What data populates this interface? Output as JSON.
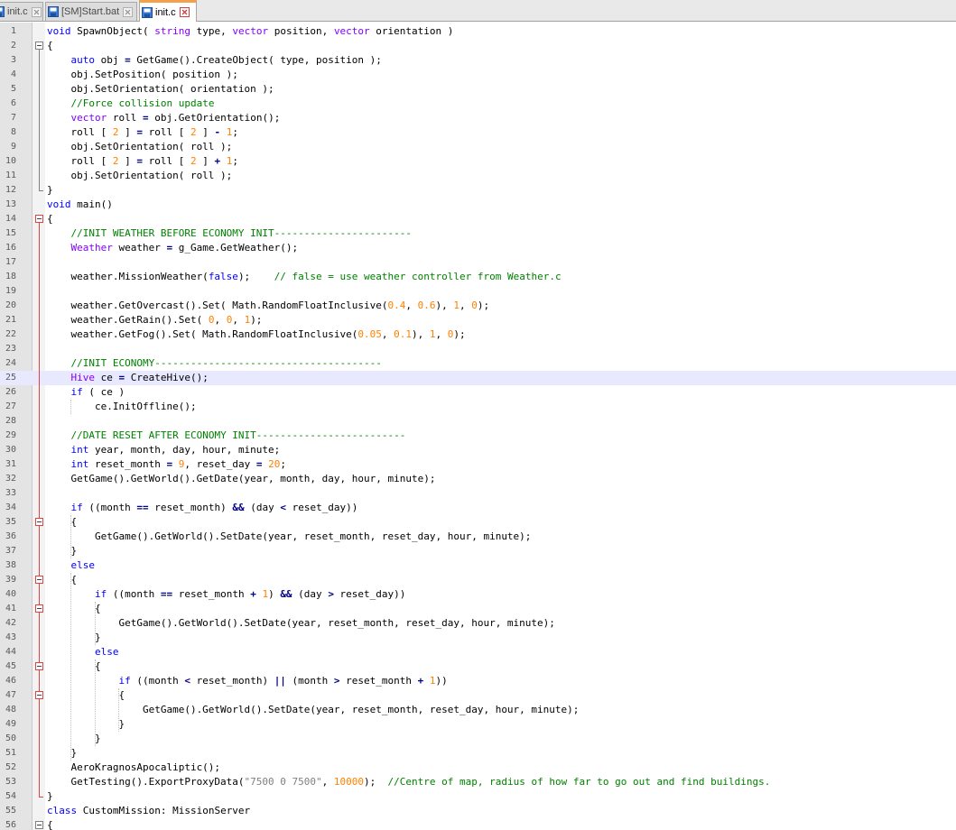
{
  "tabs": [
    {
      "label": "init.c",
      "icon": "saved-file-icon",
      "active": false,
      "close": "close-icon"
    },
    {
      "label": "[SM]Start.bat",
      "icon": "saved-file-icon",
      "active": false,
      "close": "close-icon"
    },
    {
      "label": "init.c",
      "icon": "saved-file-icon",
      "active": true,
      "close": "close-icon"
    }
  ],
  "colors": {
    "keyword": "#0000ff",
    "type": "#8000ff",
    "number": "#ff8000",
    "string": "#808080",
    "comment": "#008000",
    "operator": "#000080",
    "current_line": "#e8e8ff",
    "fold_active": "#dd4444",
    "tab_accent": "#f5a14b"
  },
  "editor": {
    "current_line": 25,
    "lines": [
      {
        "n": "1",
        "code": "void SpawnObject( string type, vector position, vector orientation )"
      },
      {
        "n": "2",
        "code": "{"
      },
      {
        "n": "3",
        "code": "    auto obj = GetGame().CreateObject( type, position );"
      },
      {
        "n": "4",
        "code": "    obj.SetPosition( position );"
      },
      {
        "n": "5",
        "code": "    obj.SetOrientation( orientation );"
      },
      {
        "n": "6",
        "code": "    //Force collision update"
      },
      {
        "n": "7",
        "code": "    vector roll = obj.GetOrientation();"
      },
      {
        "n": "8",
        "code": "    roll [ 2 ] = roll [ 2 ] - 1;"
      },
      {
        "n": "9",
        "code": "    obj.SetOrientation( roll );"
      },
      {
        "n": "10",
        "code": "    roll [ 2 ] = roll [ 2 ] + 1;"
      },
      {
        "n": "11",
        "code": "    obj.SetOrientation( roll );"
      },
      {
        "n": "12",
        "code": "}"
      },
      {
        "n": "13",
        "code": "void main()"
      },
      {
        "n": "14",
        "code": "{"
      },
      {
        "n": "15",
        "code": "    //INIT WEATHER BEFORE ECONOMY INIT-----------------------"
      },
      {
        "n": "16",
        "code": "    Weather weather = g_Game.GetWeather();"
      },
      {
        "n": "17",
        "code": ""
      },
      {
        "n": "18",
        "code": "    weather.MissionWeather(false);    // false = use weather controller from Weather.c"
      },
      {
        "n": "19",
        "code": ""
      },
      {
        "n": "20",
        "code": "    weather.GetOvercast().Set( Math.RandomFloatInclusive(0.4, 0.6), 1, 0);"
      },
      {
        "n": "21",
        "code": "    weather.GetRain().Set( 0, 0, 1);"
      },
      {
        "n": "22",
        "code": "    weather.GetFog().Set( Math.RandomFloatInclusive(0.05, 0.1), 1, 0);"
      },
      {
        "n": "23",
        "code": ""
      },
      {
        "n": "24",
        "code": "    //INIT ECONOMY--------------------------------------"
      },
      {
        "n": "25",
        "code": "    Hive ce = CreateHive();"
      },
      {
        "n": "26",
        "code": "    if ( ce )"
      },
      {
        "n": "27",
        "code": "        ce.InitOffline();"
      },
      {
        "n": "28",
        "code": ""
      },
      {
        "n": "29",
        "code": "    //DATE RESET AFTER ECONOMY INIT-------------------------"
      },
      {
        "n": "30",
        "code": "    int year, month, day, hour, minute;"
      },
      {
        "n": "31",
        "code": "    int reset_month = 9, reset_day = 20;"
      },
      {
        "n": "32",
        "code": "    GetGame().GetWorld().GetDate(year, month, day, hour, minute);"
      },
      {
        "n": "33",
        "code": ""
      },
      {
        "n": "34",
        "code": "    if ((month == reset_month) && (day < reset_day))"
      },
      {
        "n": "35",
        "code": "    {"
      },
      {
        "n": "36",
        "code": "        GetGame().GetWorld().SetDate(year, reset_month, reset_day, hour, minute);"
      },
      {
        "n": "37",
        "code": "    }"
      },
      {
        "n": "38",
        "code": "    else"
      },
      {
        "n": "39",
        "code": "    {"
      },
      {
        "n": "40",
        "code": "        if ((month == reset_month + 1) && (day > reset_day))"
      },
      {
        "n": "41",
        "code": "        {"
      },
      {
        "n": "42",
        "code": "            GetGame().GetWorld().SetDate(year, reset_month, reset_day, hour, minute);"
      },
      {
        "n": "43",
        "code": "        }"
      },
      {
        "n": "44",
        "code": "        else"
      },
      {
        "n": "45",
        "code": "        {"
      },
      {
        "n": "46",
        "code": "            if ((month < reset_month) || (month > reset_month + 1))"
      },
      {
        "n": "47",
        "code": "            {"
      },
      {
        "n": "48",
        "code": "                GetGame().GetWorld().SetDate(year, reset_month, reset_day, hour, minute);"
      },
      {
        "n": "49",
        "code": "            }"
      },
      {
        "n": "50",
        "code": "        }"
      },
      {
        "n": "51",
        "code": "    }"
      },
      {
        "n": "52",
        "code": "    AeroKragnosApocaliptic();"
      },
      {
        "n": "53",
        "code": "    GetTesting().ExportProxyData(\"7500 0 7500\", 10000);  //Centre of map, radius of how far to go out and find buildings."
      },
      {
        "n": "54",
        "code": "}"
      },
      {
        "n": "55",
        "code": "class CustomMission: MissionServer"
      },
      {
        "n": "56",
        "code": "{"
      }
    ]
  }
}
